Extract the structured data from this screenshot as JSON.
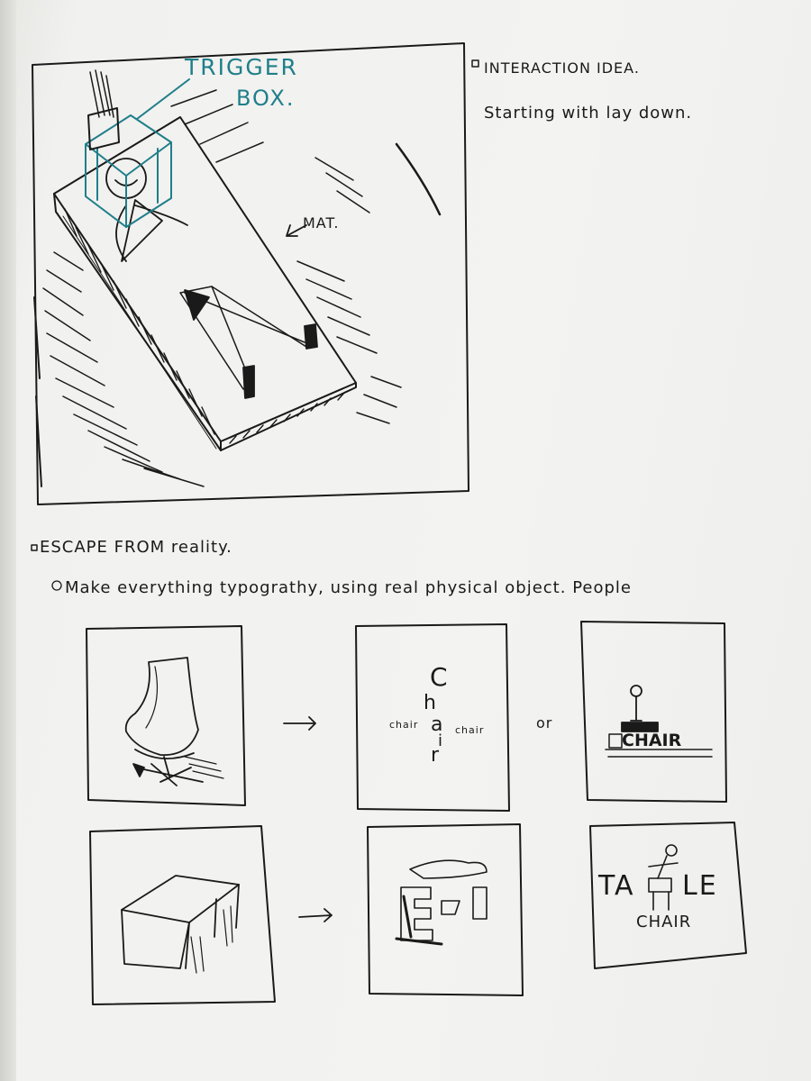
{
  "sketch_top": {
    "trigger_label": "TRIGGER",
    "box_label": "BOX.",
    "mat_label": "MAT."
  },
  "notes_top": {
    "heading": "INTERACTION IDEA.",
    "line1": "Starting with lay down."
  },
  "escape": {
    "heading": "ESCAPE FROM reality.",
    "line1": "Make everything typograthy, using real physical object. ",
    "line1_tail": "People"
  },
  "panels": {
    "chair_letters": [
      "C",
      "h",
      "a",
      "i",
      "r"
    ],
    "chair_small_left": "chair",
    "chair_small_right": "chair",
    "or_label": "or",
    "chair_word": "CHAIR",
    "table_word_left": "TA",
    "table_word_right": "LE",
    "table_chair_word": "CHAIR"
  }
}
